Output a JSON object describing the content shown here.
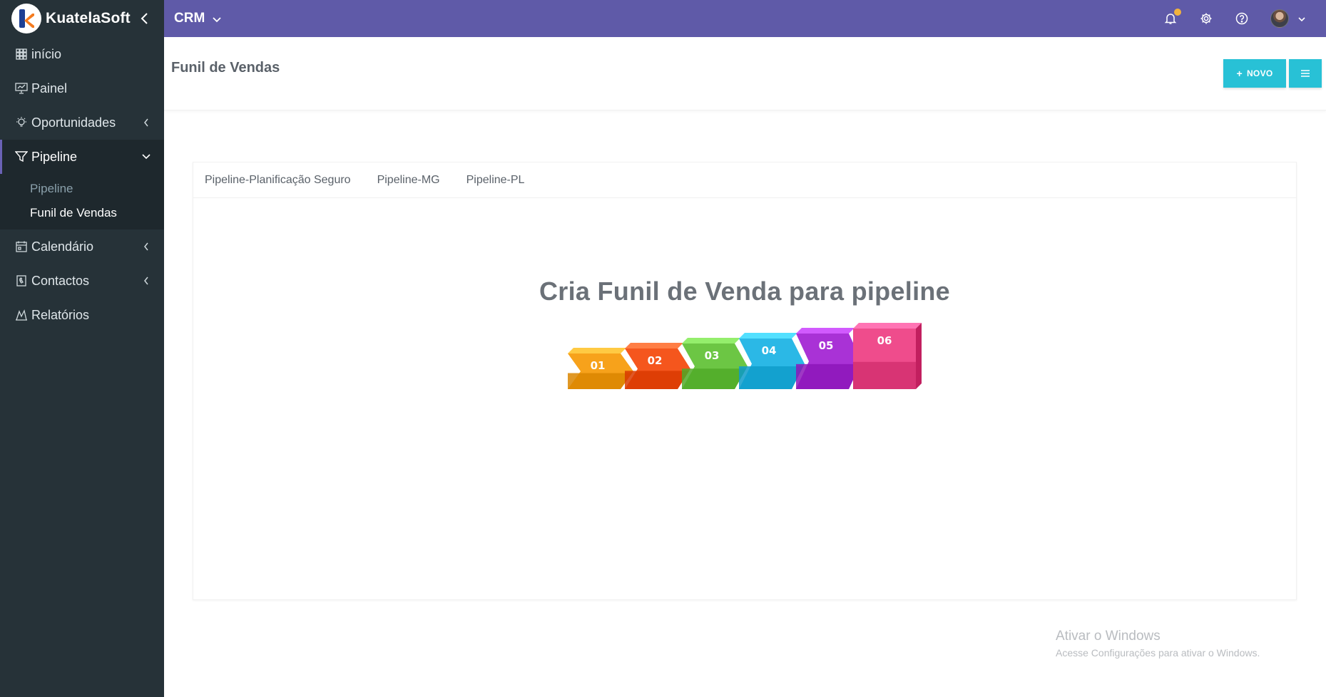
{
  "brand": {
    "name": "KuatelaSoft"
  },
  "topbar": {
    "module": "CRM",
    "accent": "#5f5aa8"
  },
  "sidebar": {
    "items": [
      {
        "label": "início",
        "icon": "dashboard-grid-icon"
      },
      {
        "label": "Painel",
        "icon": "presentation-board-icon"
      },
      {
        "label": "Oportunidades",
        "icon": "lightbulb-icon"
      },
      {
        "label": "Pipeline",
        "icon": "funnel-icon"
      },
      {
        "label": "Calendário",
        "icon": "calendar-icon"
      },
      {
        "label": "Contactos",
        "icon": "phone-book-icon"
      },
      {
        "label": "Relatórios",
        "icon": "chart-icon"
      }
    ],
    "subitems": [
      {
        "label": "Pipeline"
      },
      {
        "label": "Funil de Vendas"
      }
    ]
  },
  "page": {
    "title": "Funil de Vendas",
    "new_button": "NOVO",
    "button_color": "#28c1d6"
  },
  "tabs": [
    {
      "label": "Pipeline-Planificação Seguro"
    },
    {
      "label": "Pipeline-MG"
    },
    {
      "label": "Pipeline-PL"
    }
  ],
  "empty_state": {
    "title": "Cria Funil de Venda para pipeline",
    "steps": [
      {
        "label": "01",
        "color": "#f7a21b"
      },
      {
        "label": "02",
        "color": "#f5561d"
      },
      {
        "label": "03",
        "color": "#6cc644"
      },
      {
        "label": "04",
        "color": "#2bb8e6"
      },
      {
        "label": "05",
        "color": "#a932d6"
      },
      {
        "label": "06",
        "color": "#ef4c8c"
      }
    ]
  },
  "watermark": {
    "line1": "Ativar o Windows",
    "line2": "Acesse Configurações para ativar o Windows."
  }
}
